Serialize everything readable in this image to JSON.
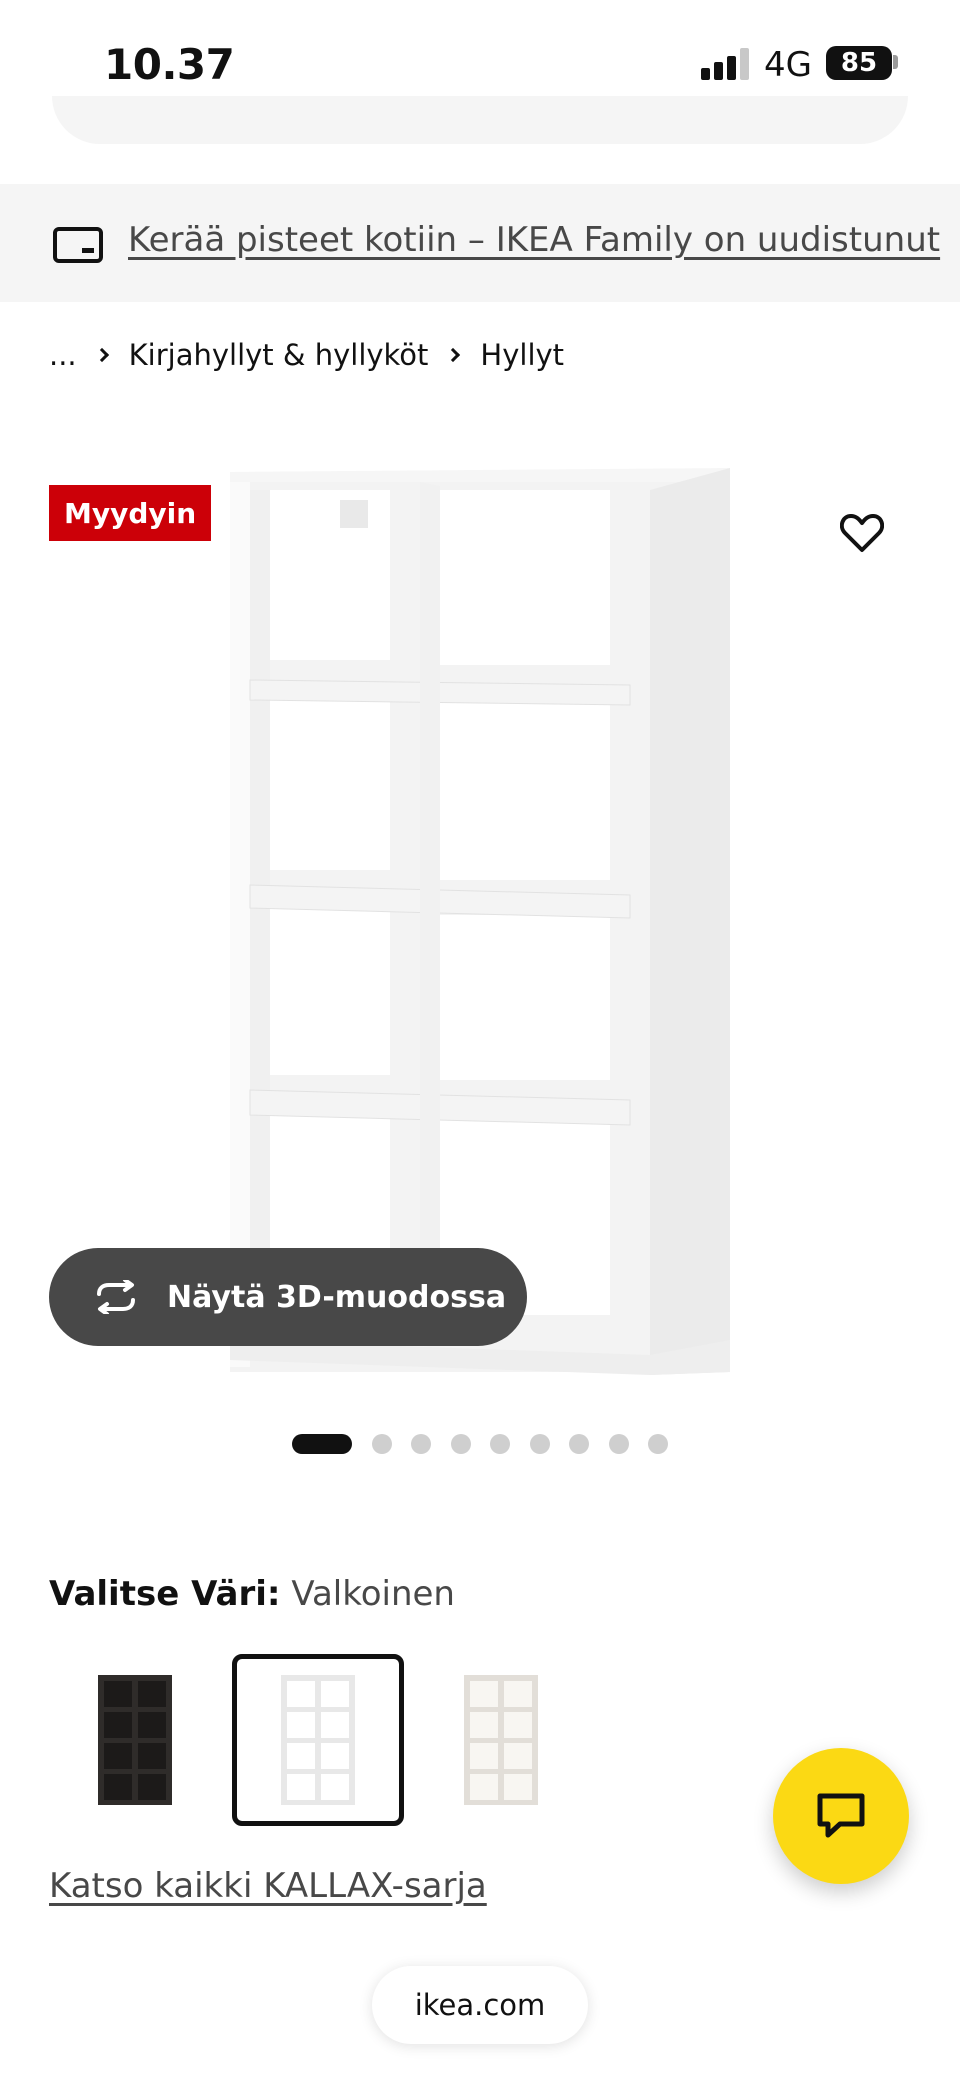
{
  "status_bar": {
    "time": "10.37",
    "network": "4G",
    "battery": "85"
  },
  "banner": {
    "text": "Kerää pisteet kotiin – IKEA Family on uudistunut",
    "icon": "card-icon"
  },
  "breadcrumb": {
    "items": [
      "...",
      "Kirjahyllyt & hyllyköt",
      "Hyllyt"
    ]
  },
  "product": {
    "badge": "Myydyin",
    "view_3d_label": "Näytä 3D-muodossa",
    "image_count": 9,
    "active_image": 1
  },
  "color_selection": {
    "label": "Valitse Väri:",
    "selected": "Valkoinen",
    "options": [
      "black-brown",
      "white",
      "white-stained-oak"
    ]
  },
  "series_link": "Katso kaikki KALLAX-sarja",
  "browser": {
    "address": "ikea.com"
  },
  "colors": {
    "badge": "#cc0008",
    "chat_button": "#fbd914",
    "view3d_button": "#484848"
  }
}
